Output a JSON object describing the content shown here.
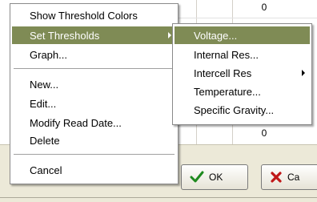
{
  "background": {
    "cell_values": [
      "0",
      "0"
    ],
    "ok_label": "OK",
    "cancel_label": "Ca"
  },
  "context_menu": {
    "items": [
      {
        "label": "Show Threshold Colors"
      },
      {
        "label": "Set Thresholds",
        "has_submenu": true,
        "highlighted": true
      },
      {
        "label": "Graph..."
      },
      {
        "label": "New..."
      },
      {
        "label": "Edit..."
      },
      {
        "label": "Modify Read Date..."
      },
      {
        "label": "Delete"
      },
      {
        "label": "Cancel"
      }
    ]
  },
  "submenu": {
    "items": [
      {
        "label": "Voltage...",
        "highlighted": true
      },
      {
        "label": "Internal Res..."
      },
      {
        "label": "Intercell Res",
        "has_submenu": true
      },
      {
        "label": "Temperature..."
      },
      {
        "label": "Specific Gravity..."
      }
    ]
  },
  "colors": {
    "highlight": "#7f8b55",
    "menu_background": "#ffffff",
    "window_background": "#ece9d8"
  },
  "icons": {
    "ok": "green-checkmark-icon",
    "cancel": "red-x-icon",
    "submenu_arrow": "submenu-arrow-icon"
  }
}
